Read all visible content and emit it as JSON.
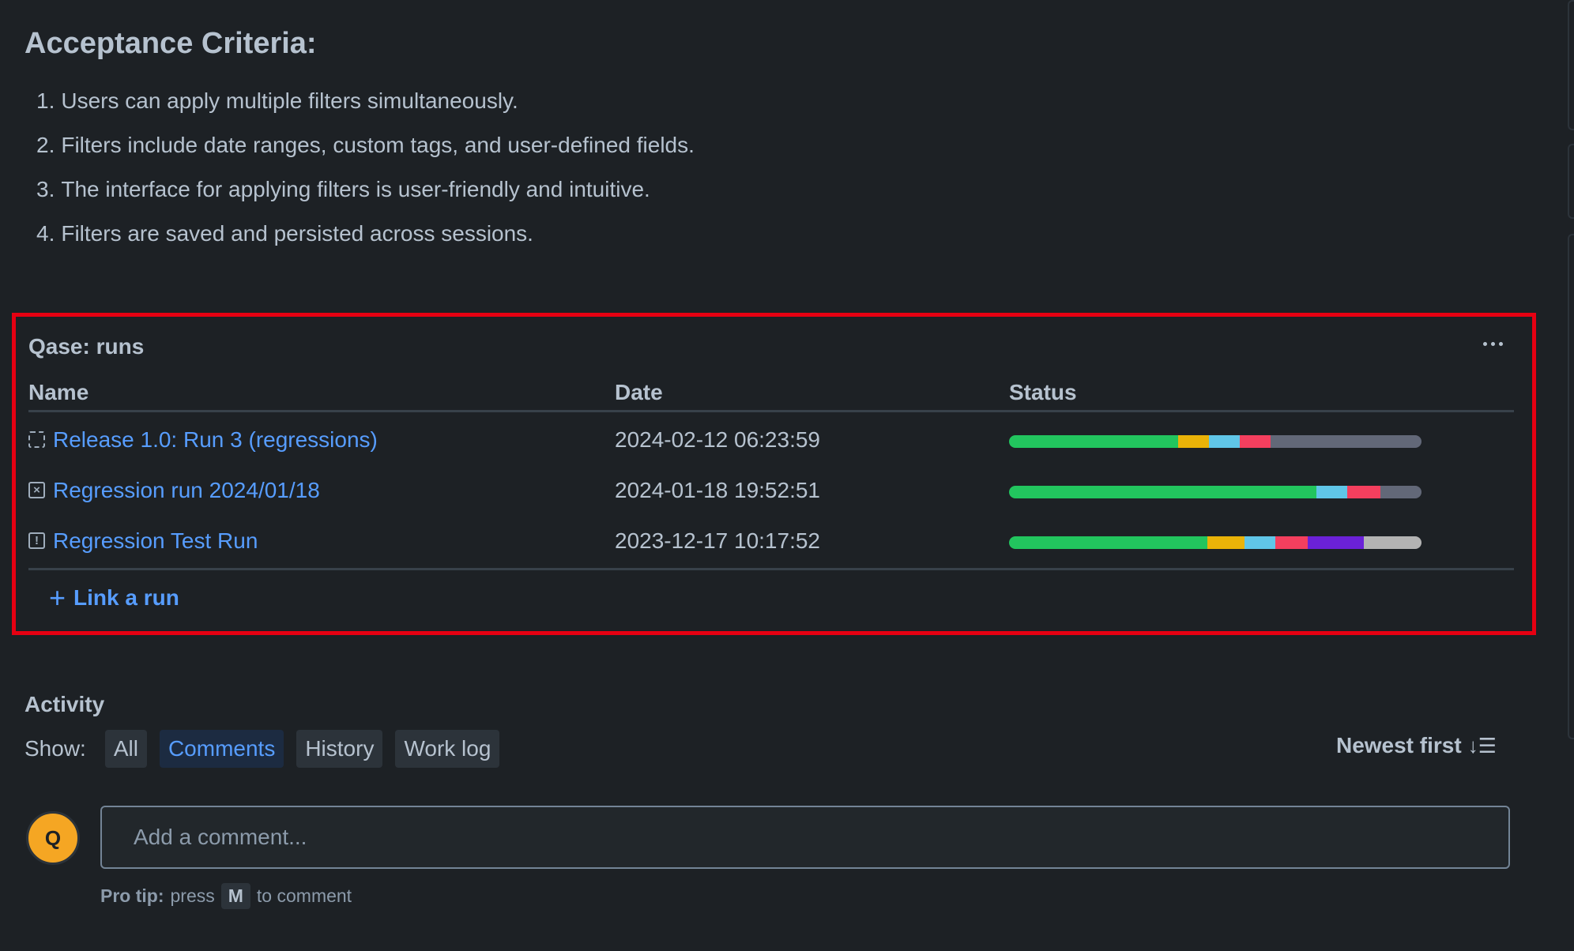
{
  "acceptance": {
    "title": "Acceptance Criteria:",
    "items": [
      {
        "num": "1.",
        "text": "Users can apply multiple filters simultaneously."
      },
      {
        "num": "2.",
        "text": "Filters include date ranges, custom tags, and user-defined fields."
      },
      {
        "num": "3.",
        "text": "The interface for applying filters is user-friendly and intuitive."
      },
      {
        "num": "4.",
        "text": "Filters are saved and persisted across sessions."
      }
    ]
  },
  "runs_panel": {
    "title": "Qase: runs",
    "more_icon": "more-horizontal-icon",
    "headers": {
      "name": "Name",
      "date": "Date",
      "status": "Status"
    },
    "rows": [
      {
        "icon": "run-in-progress-icon",
        "name": "Release 1.0: Run 3 (regressions)",
        "date": "2024-02-12 06:23:59",
        "status_segments": [
          {
            "status": "passed",
            "fraction": 0.41,
            "color": "#22c55e"
          },
          {
            "status": "blocked",
            "fraction": 0.075,
            "color": "#eab308"
          },
          {
            "status": "skipped",
            "fraction": 0.075,
            "color": "#60c6e8"
          },
          {
            "status": "failed",
            "fraction": 0.075,
            "color": "#f43f5e"
          },
          {
            "status": "untested",
            "fraction": 0.365,
            "color": "#626878"
          }
        ]
      },
      {
        "icon": "run-aborted-icon",
        "name": "Regression run 2024/01/18",
        "date": "2024-01-18 19:52:51",
        "status_segments": [
          {
            "status": "passed",
            "fraction": 0.745,
            "color": "#22c55e"
          },
          {
            "status": "skipped",
            "fraction": 0.075,
            "color": "#60c6e8"
          },
          {
            "status": "failed",
            "fraction": 0.08,
            "color": "#f43f5e"
          },
          {
            "status": "untested",
            "fraction": 0.1,
            "color": "#626878"
          }
        ]
      },
      {
        "icon": "run-warning-icon",
        "name": "Regression Test Run",
        "date": "2023-12-17 10:17:52",
        "status_segments": [
          {
            "status": "passed",
            "fraction": 0.48,
            "color": "#22c55e"
          },
          {
            "status": "blocked",
            "fraction": 0.09,
            "color": "#eab308"
          },
          {
            "status": "skipped",
            "fraction": 0.075,
            "color": "#60c6e8"
          },
          {
            "status": "failed",
            "fraction": 0.08,
            "color": "#f43f5e"
          },
          {
            "status": "invalid",
            "fraction": 0.135,
            "color": "#6b21d8"
          },
          {
            "status": "retest",
            "fraction": 0.14,
            "color": "#b3b3b3"
          }
        ]
      }
    ],
    "link_label": "Link a run"
  },
  "activity": {
    "title": "Activity",
    "show_label": "Show:",
    "filters": [
      {
        "label": "All",
        "active": false
      },
      {
        "label": "Comments",
        "active": true
      },
      {
        "label": "History",
        "active": false
      },
      {
        "label": "Work log",
        "active": false
      }
    ],
    "sort_label": "Newest first",
    "avatar_initial": "Q",
    "comment_placeholder": "Add a comment...",
    "protip": {
      "lead": "Pro tip:",
      "press": "press",
      "key": "M",
      "tail": "to comment"
    }
  },
  "colors": {
    "highlight_border": "#e60012",
    "link": "#579dff",
    "avatar": "#f5a623",
    "background": "#1d2125"
  }
}
